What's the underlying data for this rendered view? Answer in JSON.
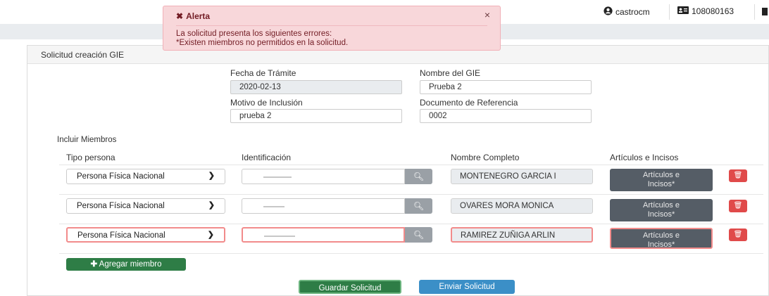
{
  "alert": {
    "title": "Alerta",
    "close": "×",
    "message_line1": "La solicitud presenta los siguientes errores:",
    "message_line2": "*Existen miembros no permitidos en la solicitud."
  },
  "user": {
    "username": "castrocm",
    "id_number": "108080163"
  },
  "panel": {
    "title": "Solicitud creación GIE"
  },
  "form": {
    "fecha_label": "Fecha de Trámite",
    "fecha_value": "2020-02-13",
    "nombre_gie_label": "Nombre del GIE",
    "nombre_gie_value": "Prueba 2",
    "motivo_label": "Motivo de Inclusión",
    "motivo_value": "prueba 2",
    "documento_label": "Documento de Referencia",
    "documento_value": "0002"
  },
  "members": {
    "section_title": "Incluir Miembros",
    "columns": [
      "Tipo persona",
      "Identificación",
      "Nombre Completo",
      "Artículos e Incisos"
    ],
    "rows": [
      {
        "tipo": "Persona Física Nacional",
        "nombre": "MONTENEGRO GARCIA I",
        "articulos": "Artículos e Incisos*",
        "error": false
      },
      {
        "tipo": "Persona Física Nacional",
        "nombre": "OVARES MORA MONICA",
        "articulos": "Artículos e Incisos*",
        "error": false
      },
      {
        "tipo": "Persona Física Nacional",
        "nombre": "RAMIREZ ZUÑIGA ARLIN",
        "articulos": "Artículos e Incisos*",
        "error": true
      }
    ],
    "add_button": "Agregar miembro"
  },
  "actions": {
    "save": "Guardar Solicitud",
    "send": "Enviar Solicitud"
  },
  "colors": {
    "alert_bg": "#f8d7da",
    "error_border": "#f28b8b",
    "success": "#2e7d46",
    "info": "#3b8fc7",
    "danger": "#e04a4a"
  }
}
